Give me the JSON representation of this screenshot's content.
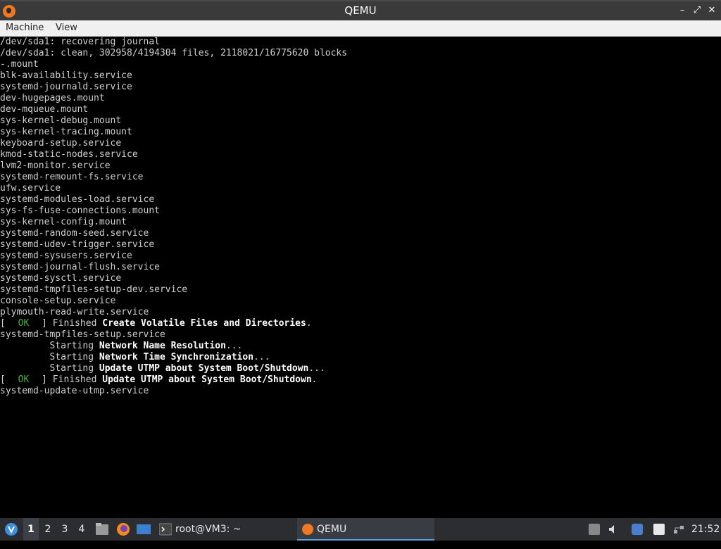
{
  "window": {
    "title": "QEMU",
    "controls": {
      "minimize": "–",
      "restore": "⤢",
      "close": "✕"
    }
  },
  "menubar": {
    "items": [
      "Machine",
      "View"
    ]
  },
  "console": {
    "lines": [
      {
        "text": "/dev/sda1: recovering journal"
      },
      {
        "text": "/dev/sda1: clean, 302958/4194304 files, 2118021/16775620 blocks"
      },
      {
        "text": "-.mount"
      },
      {
        "text": "blk-availability.service"
      },
      {
        "text": "systemd-journald.service"
      },
      {
        "text": "dev-hugepages.mount"
      },
      {
        "text": "dev-mqueue.mount"
      },
      {
        "text": "sys-kernel-debug.mount"
      },
      {
        "text": "sys-kernel-tracing.mount"
      },
      {
        "text": "keyboard-setup.service"
      },
      {
        "text": "kmod-static-nodes.service"
      },
      {
        "text": "lvm2-monitor.service"
      },
      {
        "text": "systemd-remount-fs.service"
      },
      {
        "text": "ufw.service"
      },
      {
        "text": "systemd-modules-load.service"
      },
      {
        "text": "sys-fs-fuse-connections.mount"
      },
      {
        "text": "sys-kernel-config.mount"
      },
      {
        "text": "systemd-random-seed.service"
      },
      {
        "text": "systemd-udev-trigger.service"
      },
      {
        "text": "systemd-sysusers.service"
      },
      {
        "text": "systemd-journal-flush.service"
      },
      {
        "text": "systemd-sysctl.service"
      },
      {
        "text": "systemd-tmpfiles-setup-dev.service"
      },
      {
        "text": "console-setup.service"
      },
      {
        "text": "plymouth-read-write.service"
      },
      {
        "status": "OK",
        "prefix": " Finished ",
        "highlight": "Create Volatile Files and Directories",
        "suffix": "."
      },
      {
        "text": "systemd-tmpfiles-setup.service"
      },
      {
        "prefix": "         Starting ",
        "highlight": "Network Name Resolution",
        "suffix": "..."
      },
      {
        "prefix": "         Starting ",
        "highlight": "Network Time Synchronization",
        "suffix": "..."
      },
      {
        "prefix": "         Starting ",
        "highlight": "Update UTMP about System Boot/Shutdown",
        "suffix": "..."
      },
      {
        "status": "OK",
        "prefix": " Finished ",
        "highlight": "Update UTMP about System Boot/Shutdown",
        "suffix": "."
      },
      {
        "text": "systemd-update-utmp.service"
      }
    ]
  },
  "taskbar": {
    "workspaces": [
      "1",
      "2",
      "3",
      "4"
    ],
    "active_workspace": "1",
    "tasks": [
      {
        "label": "root@VM3: ~",
        "icon": "terminal-icon"
      },
      {
        "label": "QEMU",
        "icon": "qemu-icon",
        "active": true
      }
    ],
    "clock": "21:52"
  },
  "colors": {
    "ok_green": "#3fb73f",
    "console_text": "#cfcfcf",
    "titlebar_bg": "#3a3a3a",
    "taskbar_bg": "#2b2d31"
  }
}
